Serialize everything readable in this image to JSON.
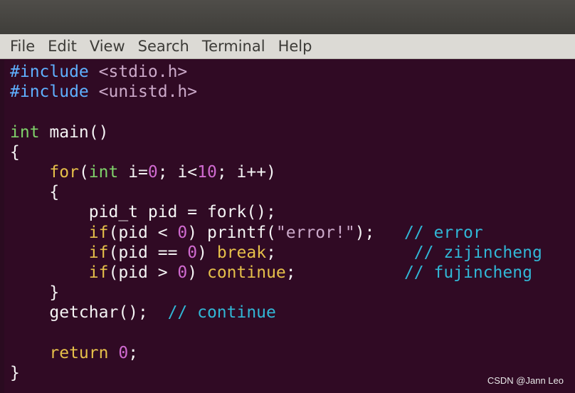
{
  "menu": [
    "File",
    "Edit",
    "View",
    "Search",
    "Terminal",
    "Help"
  ],
  "code": [
    [
      {
        "t": "#include",
        "c": "pp"
      },
      {
        "t": " ",
        "c": "plain"
      },
      {
        "t": "<stdio.h>",
        "c": "hdr"
      }
    ],
    [
      {
        "t": "#include",
        "c": "pp"
      },
      {
        "t": " ",
        "c": "plain"
      },
      {
        "t": "<unistd.h>",
        "c": "hdr"
      }
    ],
    [],
    [
      {
        "t": "int",
        "c": "type"
      },
      {
        "t": " main()",
        "c": "plain"
      }
    ],
    [
      {
        "t": "{",
        "c": "plain"
      }
    ],
    [
      {
        "t": "    ",
        "c": "plain"
      },
      {
        "t": "for",
        "c": "kw"
      },
      {
        "t": "(",
        "c": "plain"
      },
      {
        "t": "int",
        "c": "type"
      },
      {
        "t": " i=",
        "c": "plain"
      },
      {
        "t": "0",
        "c": "num"
      },
      {
        "t": "; i<",
        "c": "plain"
      },
      {
        "t": "10",
        "c": "num"
      },
      {
        "t": "; i++)",
        "c": "plain"
      }
    ],
    [
      {
        "t": "    {",
        "c": "plain"
      }
    ],
    [
      {
        "t": "        pid_t pid = fork();",
        "c": "plain"
      }
    ],
    [
      {
        "t": "        ",
        "c": "plain"
      },
      {
        "t": "if",
        "c": "kw"
      },
      {
        "t": "(pid < ",
        "c": "plain"
      },
      {
        "t": "0",
        "c": "num"
      },
      {
        "t": ") printf(",
        "c": "plain"
      },
      {
        "t": "\"error!\"",
        "c": "str"
      },
      {
        "t": ");   ",
        "c": "plain"
      },
      {
        "t": "// error",
        "c": "cmt"
      }
    ],
    [
      {
        "t": "        ",
        "c": "plain"
      },
      {
        "t": "if",
        "c": "kw"
      },
      {
        "t": "(pid == ",
        "c": "plain"
      },
      {
        "t": "0",
        "c": "num"
      },
      {
        "t": ") ",
        "c": "plain"
      },
      {
        "t": "break",
        "c": "kw"
      },
      {
        "t": ";              ",
        "c": "plain"
      },
      {
        "t": "// zijincheng",
        "c": "cmt"
      }
    ],
    [
      {
        "t": "        ",
        "c": "plain"
      },
      {
        "t": "if",
        "c": "kw"
      },
      {
        "t": "(pid > ",
        "c": "plain"
      },
      {
        "t": "0",
        "c": "num"
      },
      {
        "t": ") ",
        "c": "plain"
      },
      {
        "t": "continue",
        "c": "kw"
      },
      {
        "t": ";           ",
        "c": "plain"
      },
      {
        "t": "// fujincheng",
        "c": "cmt"
      }
    ],
    [
      {
        "t": "    }",
        "c": "plain"
      }
    ],
    [
      {
        "t": "    getchar();  ",
        "c": "plain"
      },
      {
        "t": "// continue",
        "c": "cmt"
      }
    ],
    [],
    [
      {
        "t": "    ",
        "c": "plain"
      },
      {
        "t": "return",
        "c": "kw"
      },
      {
        "t": " ",
        "c": "plain"
      },
      {
        "t": "0",
        "c": "num"
      },
      {
        "t": ";",
        "c": "plain"
      }
    ],
    [
      {
        "t": "}",
        "c": "plain"
      }
    ]
  ],
  "watermark": "CSDN @Jann Leo"
}
